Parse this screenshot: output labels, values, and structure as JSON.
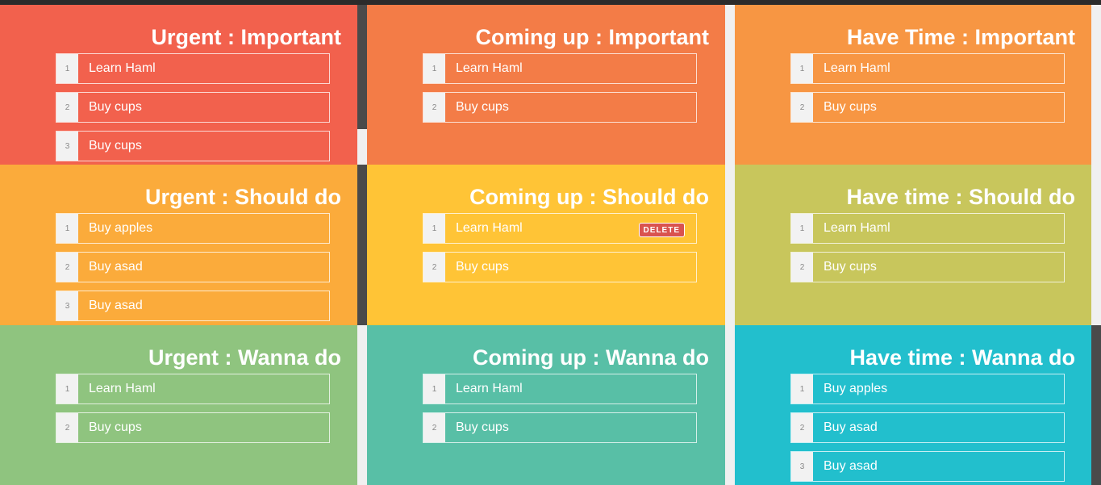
{
  "colors": {
    "urgent_important": "#f2614d",
    "comingup_important": "#f37c47",
    "havetime_important": "#f79643",
    "urgent_should": "#fbab3b",
    "comingup_should": "#ffc436",
    "havetime_should": "#c8c65c",
    "urgent_wanna": "#8fc47f",
    "comingup_wanna": "#58bfa6",
    "havetime_wanna": "#22bfcd",
    "delete": "#d9534f"
  },
  "quadrants": [
    {
      "title": "Urgent : Important",
      "items": [
        {
          "num": "1",
          "label": "Learn Haml"
        },
        {
          "num": "2",
          "label": "Buy cups"
        },
        {
          "num": "3",
          "label": "Buy cups"
        }
      ]
    },
    {
      "title": "Coming up : Important",
      "items": [
        {
          "num": "1",
          "label": "Learn Haml"
        },
        {
          "num": "2",
          "label": "Buy cups"
        }
      ]
    },
    {
      "title": "Have Time : Important",
      "items": [
        {
          "num": "1",
          "label": "Learn Haml"
        },
        {
          "num": "2",
          "label": "Buy cups"
        }
      ]
    },
    {
      "title": "Urgent : Should do",
      "items": [
        {
          "num": "1",
          "label": "Buy apples"
        },
        {
          "num": "2",
          "label": "Buy asad"
        },
        {
          "num": "3",
          "label": "Buy asad"
        }
      ]
    },
    {
      "title": "Coming up : Should do",
      "items": [
        {
          "num": "1",
          "label": "Learn Haml",
          "delete_label": "DELETE"
        },
        {
          "num": "2",
          "label": "Buy cups"
        }
      ]
    },
    {
      "title": "Have time : Should do",
      "items": [
        {
          "num": "1",
          "label": "Learn Haml"
        },
        {
          "num": "2",
          "label": "Buy cups"
        }
      ]
    },
    {
      "title": "Urgent : Wanna do",
      "items": [
        {
          "num": "1",
          "label": "Learn Haml"
        },
        {
          "num": "2",
          "label": "Buy cups"
        }
      ]
    },
    {
      "title": "Coming up : Wanna do",
      "items": [
        {
          "num": "1",
          "label": "Learn Haml"
        },
        {
          "num": "2",
          "label": "Buy cups"
        }
      ]
    },
    {
      "title": "Have time : Wanna do",
      "items": [
        {
          "num": "1",
          "label": "Buy apples"
        },
        {
          "num": "2",
          "label": "Buy asad"
        },
        {
          "num": "3",
          "label": "Buy asad"
        }
      ]
    }
  ]
}
